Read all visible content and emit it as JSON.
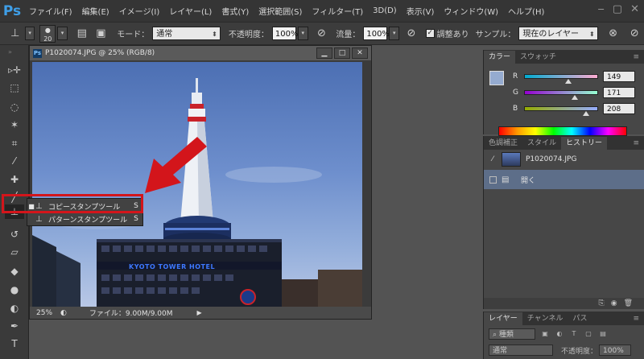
{
  "app": {
    "logo": "Ps",
    "menu": [
      "ファイル(F)",
      "編集(E)",
      "イメージ(I)",
      "レイヤー(L)",
      "書式(Y)",
      "選択範囲(S)",
      "フィルター(T)",
      "3D(D)",
      "表示(V)",
      "ウィンドウ(W)",
      "ヘルプ(H)"
    ]
  },
  "options": {
    "brush_size": "20",
    "mode_label": "モード：",
    "mode_value": "通常",
    "opacity_label": "不透明度：",
    "opacity_value": "100%",
    "flow_label": "流量：",
    "flow_value": "100%",
    "aligned_label": "調整あり",
    "sample_label": "サンプル：",
    "sample_value": "現在のレイヤー"
  },
  "document": {
    "title": "P1020074.JPG @ 25% (RGB/8)",
    "zoom": "25%",
    "file_info": "ファイル：9.00M/9.00M",
    "hotel_sign": "KYOTO TOWER HOTEL"
  },
  "flyout": {
    "items": [
      {
        "label": "コピースタンプツール",
        "key": "S",
        "selected": true
      },
      {
        "label": "パターンスタンプツール",
        "key": "S",
        "selected": false
      }
    ]
  },
  "color_panel": {
    "tabs": [
      "カラー",
      "スウォッチ"
    ],
    "r_label": "R",
    "r_value": "149",
    "g_label": "G",
    "g_value": "171",
    "b_label": "B",
    "b_value": "208",
    "foreground": "#95abd0"
  },
  "history_panel": {
    "tabs": [
      "色調補正",
      "スタイル",
      "ヒストリー"
    ],
    "snapshot": "P1020074.JPG",
    "state": "開く"
  },
  "layers_panel": {
    "tabs": [
      "レイヤー",
      "チャンネル",
      "パス"
    ],
    "kind_label": "種類",
    "blend_value": "通常",
    "opacity_label": "不透明度：",
    "opacity_value": "100%"
  },
  "colors": {
    "highlight": "#d3151b",
    "arrow": "#d3151b"
  }
}
